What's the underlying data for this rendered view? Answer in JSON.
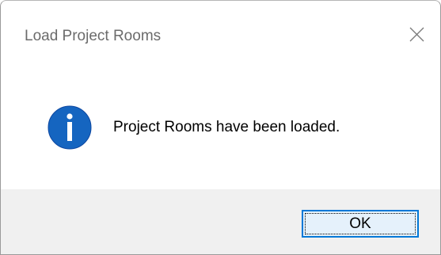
{
  "window": {
    "title": "Load Project Rooms",
    "close_icon": "close-icon"
  },
  "message": {
    "icon": "info-icon",
    "text": "Project Rooms have been loaded."
  },
  "buttons": {
    "ok_label": "OK"
  },
  "colors": {
    "accent": "#0078d7",
    "info_icon_fill": "#1565c0",
    "footer_bg": "#f0f0f0",
    "button_bg": "#e5f1fb"
  }
}
